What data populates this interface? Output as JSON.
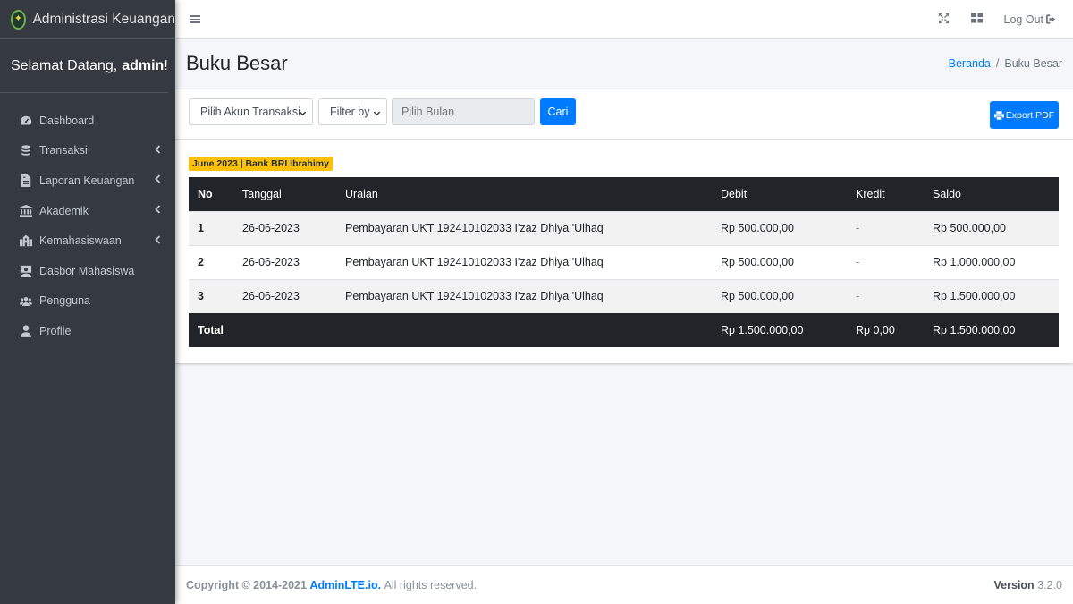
{
  "brand": {
    "title": "Administrasi Keuangan"
  },
  "welcome": {
    "prefix": "Selamat Datang,",
    "user": "admin",
    "suffix": "!"
  },
  "sidebar": {
    "items": [
      {
        "label": "Dashboard",
        "icon": "dashboard-icon",
        "has_children": false
      },
      {
        "label": "Transaksi",
        "icon": "coins-icon",
        "has_children": true
      },
      {
        "label": "Laporan Keuangan",
        "icon": "file-invoice-icon",
        "has_children": true
      },
      {
        "label": "Akademik",
        "icon": "university-icon",
        "has_children": true
      },
      {
        "label": "Kemahasiswaan",
        "icon": "school-icon",
        "has_children": true
      },
      {
        "label": "Dasbor Mahasiswa",
        "icon": "student-icon",
        "has_children": false
      },
      {
        "label": "Pengguna",
        "icon": "users-icon",
        "has_children": false
      },
      {
        "label": "Profile",
        "icon": "user-icon",
        "has_children": false
      }
    ]
  },
  "navbar": {
    "logout_label": "Log Out"
  },
  "page": {
    "title": "Buku Besar",
    "breadcrumb": {
      "home": "Beranda",
      "separator": "/",
      "current": "Buku Besar"
    }
  },
  "filters": {
    "account_select": "Pilih Akun Transaksi",
    "filter_select": "Filter by",
    "month_placeholder": "Pilih Bulan",
    "search_button": "Cari",
    "export_button": "Export PDF"
  },
  "ledger": {
    "badge": "June 2023 | Bank BRI Ibrahimy",
    "columns": [
      "No",
      "Tanggal",
      "Uraian",
      "Debit",
      "Kredit",
      "Saldo"
    ],
    "rows": [
      [
        "1",
        "26-06-2023",
        "Pembayaran UKT 192410102033 I'zaz Dhiya 'Ulhaq",
        "Rp 500.000,00",
        "-",
        "Rp 500.000,00"
      ],
      [
        "2",
        "26-06-2023",
        "Pembayaran UKT 192410102033 I'zaz Dhiya 'Ulhaq",
        "Rp 500.000,00",
        "-",
        "Rp 1.000.000,00"
      ],
      [
        "3",
        "26-06-2023",
        "Pembayaran UKT 192410102033 I'zaz Dhiya 'Ulhaq",
        "Rp 500.000,00",
        "-",
        "Rp 1.500.000,00"
      ]
    ],
    "total": {
      "label": "Total",
      "debit": "Rp 1.500.000,00",
      "kredit": "Rp 0,00",
      "saldo": "Rp 1.500.000,00"
    }
  },
  "footer": {
    "copyright": "Copyright © 2014-2021",
    "link": "AdminLTE.io.",
    "rights": "All rights reserved.",
    "version_label": "Version",
    "version": "3.2.0"
  },
  "colors": {
    "primary": "#007bff",
    "sidebar_bg": "#343a40",
    "badge_bg": "#ffc107",
    "table_dark": "#212529"
  }
}
